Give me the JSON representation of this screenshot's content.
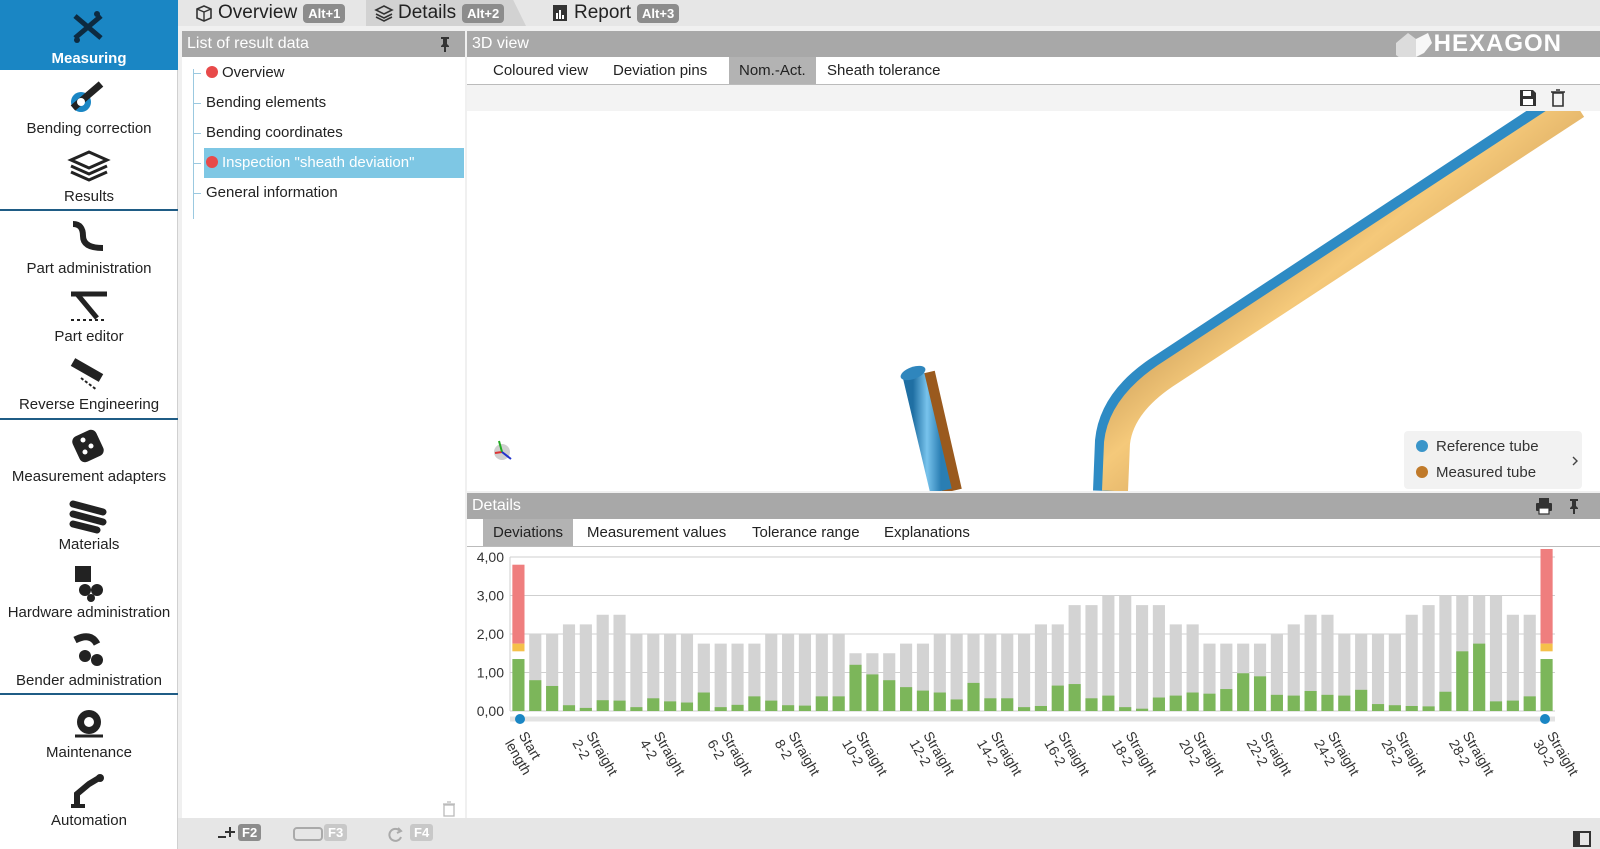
{
  "sidebar": {
    "items": [
      {
        "label": "Measuring",
        "icon": "measuring-icon"
      },
      {
        "label": "Bending correction",
        "icon": "bending-correction-icon"
      },
      {
        "label": "Results",
        "icon": "results-icon"
      },
      {
        "label": "Part administration",
        "icon": "part-administration-icon"
      },
      {
        "label": "Part editor",
        "icon": "part-editor-icon"
      },
      {
        "label": "Reverse Engineering",
        "icon": "reverse-engineering-icon"
      },
      {
        "label": "Measurement adapters",
        "icon": "measurement-adapters-icon"
      },
      {
        "label": "Materials",
        "icon": "materials-icon"
      },
      {
        "label": "Hardware administration",
        "icon": "hardware-administration-icon"
      },
      {
        "label": "Bender administration",
        "icon": "bender-administration-icon"
      },
      {
        "label": "Maintenance",
        "icon": "maintenance-icon"
      },
      {
        "label": "Automation",
        "icon": "automation-icon"
      }
    ]
  },
  "top_tabs": [
    {
      "label": "Overview",
      "shortcut": "Alt+1"
    },
    {
      "label": "Details",
      "shortcut": "Alt+2"
    },
    {
      "label": "Report",
      "shortcut": "Alt+3"
    }
  ],
  "result_list": {
    "title": "List of result data",
    "items": [
      {
        "label": "Overview",
        "status": "error"
      },
      {
        "label": "Bending elements",
        "status": "none"
      },
      {
        "label": "Bending coordinates",
        "status": "none"
      },
      {
        "label": "Inspection \"sheath deviation\"",
        "status": "error"
      },
      {
        "label": "General information",
        "status": "none"
      }
    ]
  },
  "view3d": {
    "title": "3D view",
    "brand": "HEXAGON",
    "tabs": [
      "Coloured view",
      "Deviation pins",
      "Nom.-Act.",
      "Sheath tolerance"
    ],
    "legend": [
      {
        "label": "Reference tube",
        "color": "#3a95c9"
      },
      {
        "label": "Measured tube",
        "color": "#c07a2a"
      }
    ]
  },
  "details": {
    "title": "Details",
    "tabs": [
      "Deviations",
      "Measurement values",
      "Tolerance range",
      "Explanations"
    ]
  },
  "bottom": {
    "shortcuts": [
      "F2",
      "F3",
      "F4"
    ]
  },
  "colors": {
    "accent": "#1a86c4",
    "bar_ok": "#7cb65a",
    "bar_tolerance": "#d3d3d3",
    "bar_error": "#ef7e7e",
    "bar_warn": "#f5c04a"
  },
  "chart_data": {
    "type": "bar",
    "ylim": [
      0,
      4
    ],
    "yticks": [
      "4,00",
      "3,00",
      "2,00",
      "1,00",
      "0,00"
    ],
    "x_tick_labels": [
      "Start length",
      "Straight 2-2",
      "Straight 4-2",
      "Straight 6-2",
      "Straight 8-2",
      "Straight 10-2",
      "Straight 12-2",
      "Straight 14-2",
      "Straight 16-2",
      "Straight 18-2",
      "Straight 20-2",
      "Straight 22-2",
      "Straight 24-2",
      "Straight 26-2",
      "Straight 28-2",
      "Straight 30-2"
    ],
    "series": [
      {
        "values": [
          1.35,
          0.8,
          0.65,
          0.15,
          0.08,
          0.28,
          0.27,
          0.1,
          0.33,
          0.25,
          0.22,
          0.48,
          0.1,
          0.16,
          0.38,
          0.27,
          0.15,
          0.14,
          0.38,
          0.38,
          1.2,
          0.95,
          0.8,
          0.62,
          0.53,
          0.48,
          0.3,
          0.73,
          0.33,
          0.33,
          0.1,
          0.13,
          0.66,
          0.7,
          0.33,
          0.4,
          0.1,
          0.06,
          0.35,
          0.4,
          0.48,
          0.45,
          0.57,
          0.98,
          0.9,
          0.42,
          0.4,
          0.52,
          0.42,
          0.4,
          0.55,
          0.18,
          0.15,
          0.13,
          0.12,
          0.5,
          1.55,
          1.75,
          0.25,
          0.27,
          0.38,
          1.35
        ]
      },
      {
        "values": [
          3.8,
          2.0,
          2.0,
          2.25,
          2.25,
          2.5,
          2.5,
          2.0,
          2.0,
          2.0,
          2.0,
          1.75,
          1.75,
          1.75,
          1.75,
          2.0,
          2.0,
          2.0,
          2.0,
          2.0,
          1.5,
          1.5,
          1.5,
          1.75,
          1.75,
          2.0,
          2.0,
          2.0,
          2.0,
          2.0,
          2.0,
          2.25,
          2.25,
          2.75,
          2.75,
          3.0,
          3.0,
          2.75,
          2.75,
          2.25,
          2.25,
          1.75,
          1.75,
          1.75,
          1.75,
          2.0,
          2.25,
          2.5,
          2.5,
          2.0,
          2.0,
          2.0,
          2.0,
          2.5,
          2.75,
          3.0,
          3.0,
          3.0,
          3.0,
          2.5,
          2.5,
          4.55
        ]
      }
    ]
  }
}
